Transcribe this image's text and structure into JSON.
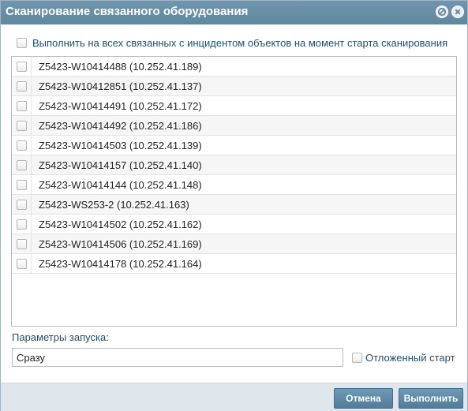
{
  "dialog": {
    "title": "Сканирование связанного оборудования",
    "settings_icon": "settings-circle-icon",
    "close_icon": "close-circle-icon"
  },
  "top_option": {
    "label": "Выполнить на всех связанных с инцидентом объектов на момент старта сканирования",
    "checked": false
  },
  "devices": [
    {
      "label": "Z5423-W10414488 (10.252.41.189)",
      "checked": false
    },
    {
      "label": "Z5423-W10412851 (10.252.41.137)",
      "checked": false
    },
    {
      "label": "Z5423-W10414491 (10.252.41.172)",
      "checked": false
    },
    {
      "label": "Z5423-W10414492 (10.252.41.186)",
      "checked": false
    },
    {
      "label": "Z5423-W10414503 (10.252.41.139)",
      "checked": false
    },
    {
      "label": "Z5423-W10414157 (10.252.41.140)",
      "checked": false
    },
    {
      "label": "Z5423-W10414144 (10.252.41.148)",
      "checked": false
    },
    {
      "label": "Z5423-WS253-2 (10.252.41.163)",
      "checked": false
    },
    {
      "label": "Z5423-W10414502 (10.252.41.162)",
      "checked": false
    },
    {
      "label": "Z5423-W10414506 (10.252.41.169)",
      "checked": false
    },
    {
      "label": "Z5423-W10414178 (10.252.41.164)",
      "checked": false
    }
  ],
  "params": {
    "label": "Параметры запуска:",
    "value": "Сразу"
  },
  "delayed_start": {
    "label": "Отложенный старт",
    "checked": false
  },
  "footer": {
    "cancel_label": "Отмена",
    "run_label": "Выполнить"
  }
}
